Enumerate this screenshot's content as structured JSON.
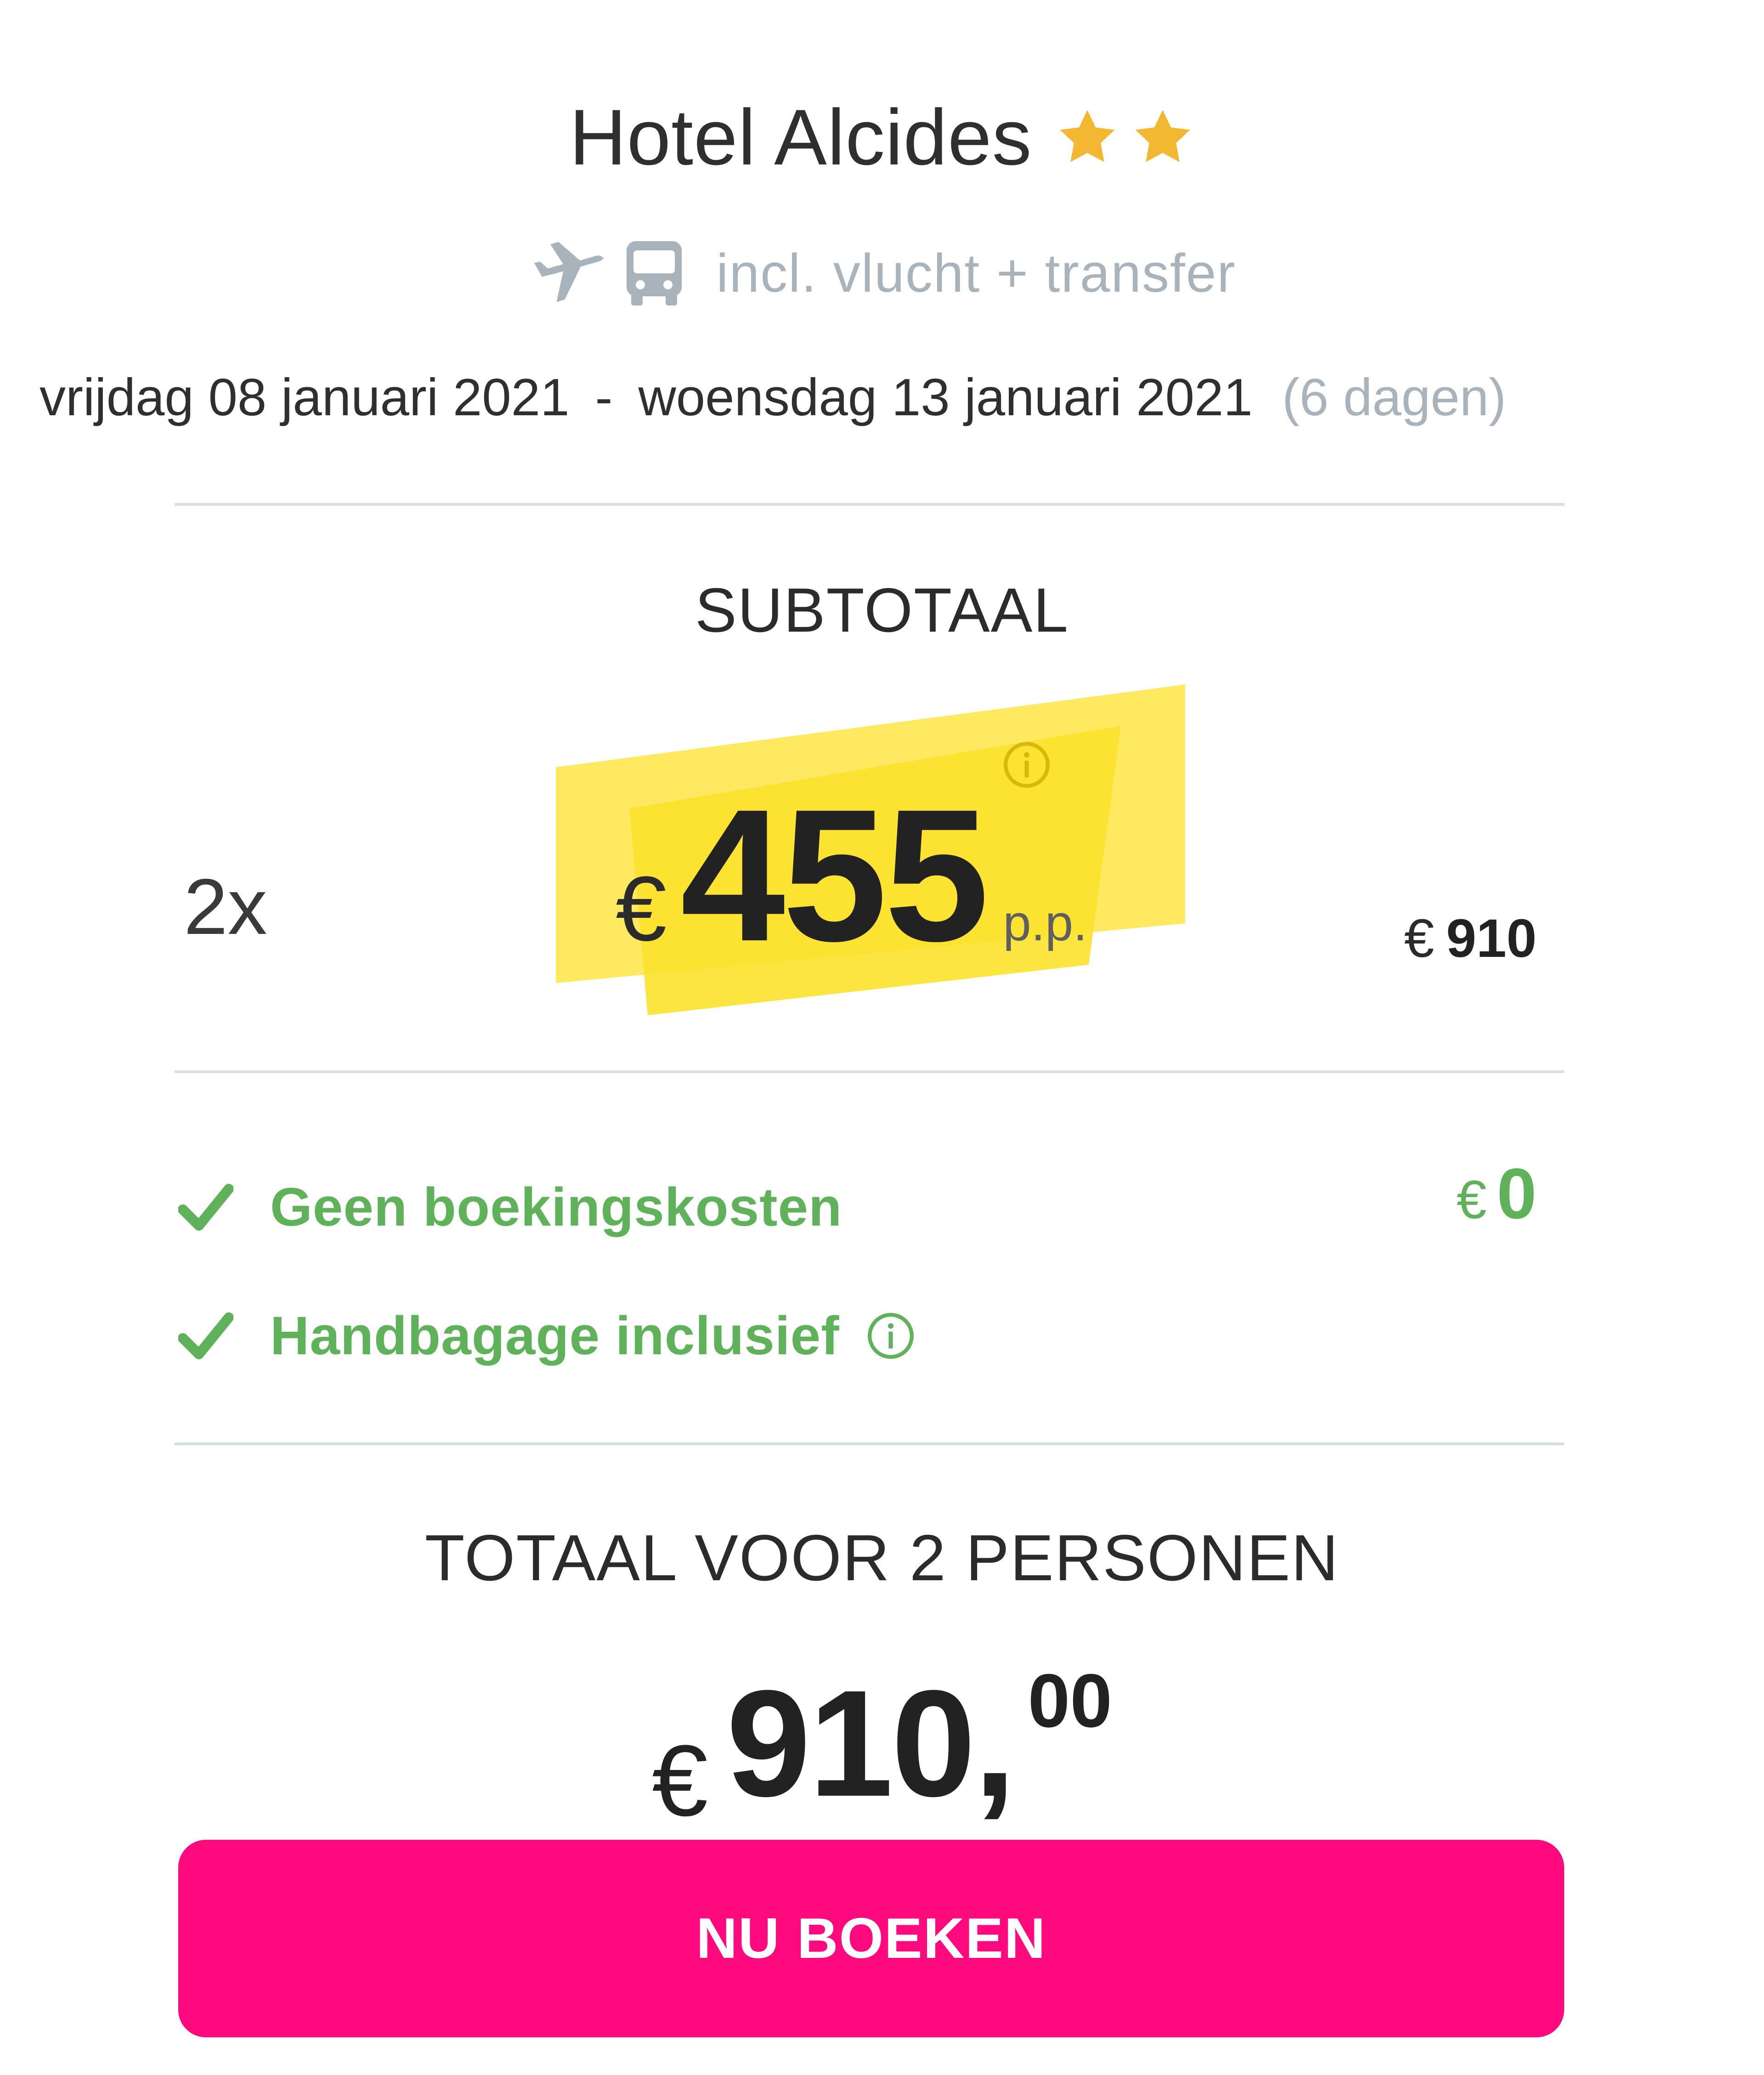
{
  "header": {
    "hotel_name": "Hotel Alcides",
    "star_rating": 2,
    "star_icon": "star-icon",
    "star_color": "#f4b731",
    "included_icons": [
      "plane-icon",
      "bus-icon"
    ],
    "included_text": "incl. vlucht + transfer",
    "date_start": "vrijdag 08 januari 2021",
    "date_separator": "-",
    "date_end": "woensdag 13 januari 2021",
    "duration": "(6 dagen)"
  },
  "subtotal": {
    "heading": "SUBTOTAAL",
    "quantity": "2x",
    "currency": "€",
    "price_per_person": "455",
    "per_person_label": "p.p.",
    "row_total": "910",
    "highlight_color": "#fde22c"
  },
  "benefits": {
    "items": [
      {
        "label": "Geen boekingskosten",
        "icon": "checkmark-icon"
      },
      {
        "label": "Handbagage inclusief",
        "icon": "checkmark-icon",
        "info_icon": "info-icon"
      }
    ],
    "fee_currency": "€",
    "fee_value": "0",
    "accent_color": "#5fb25a"
  },
  "total": {
    "heading": "TOTAAL VOOR 2 PERSONEN",
    "currency": "€",
    "integer": "910,",
    "decimals": "00"
  },
  "cta": {
    "label": "NU BOEKEN",
    "color": "#ff0a7e"
  }
}
